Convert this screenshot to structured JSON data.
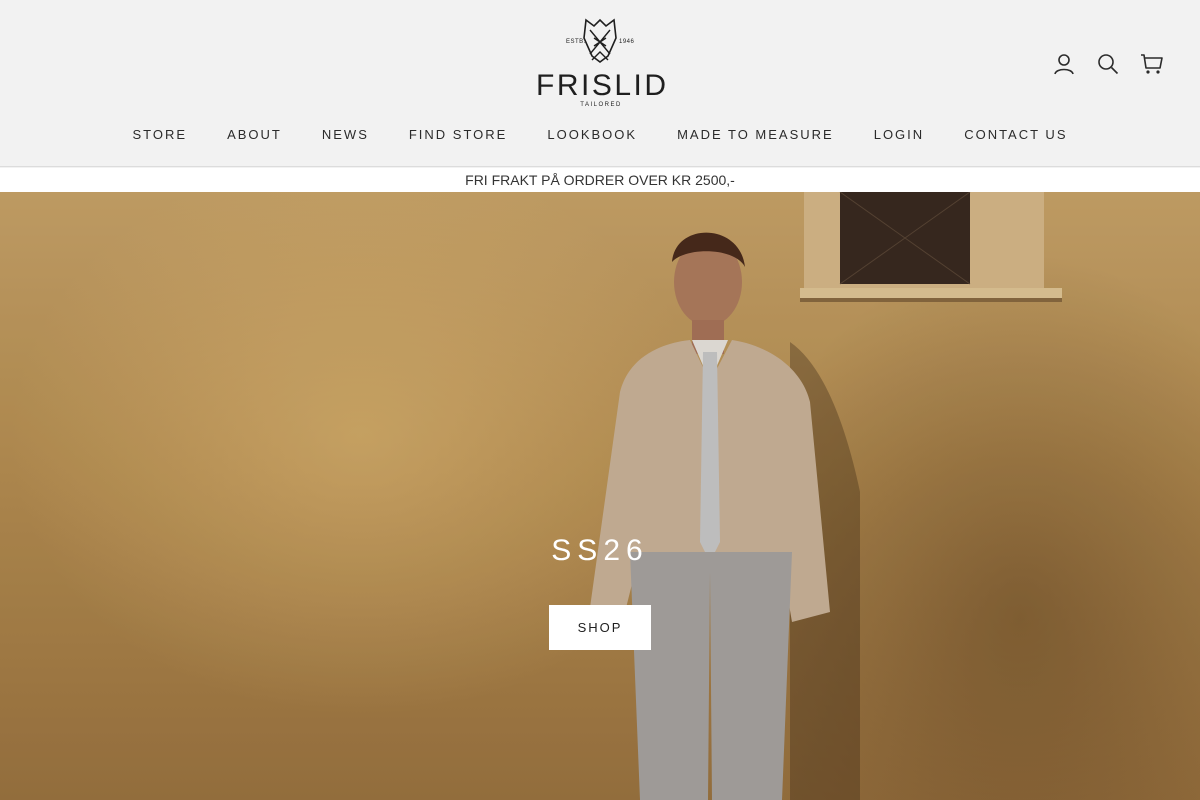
{
  "brand": {
    "name": "FRISLID",
    "tagline": "TAILORED",
    "estb": "ESTB.",
    "year": "1946"
  },
  "icons": {
    "account": "user-icon",
    "search": "search-icon",
    "cart": "cart-icon"
  },
  "nav": {
    "items": [
      {
        "label": "STORE"
      },
      {
        "label": "ABOUT"
      },
      {
        "label": "NEWS"
      },
      {
        "label": "FIND STORE"
      },
      {
        "label": "LOOKBOOK"
      },
      {
        "label": "MADE TO MEASURE"
      },
      {
        "label": "LOGIN"
      },
      {
        "label": "CONTACT US"
      }
    ]
  },
  "announcement": {
    "text": "FRI FRAKT PÅ ORDRER OVER KR 2500,-"
  },
  "hero": {
    "title": "SS26",
    "cta_label": "SHOP"
  },
  "colors": {
    "header_bg": "#f2f2f2",
    "text": "#2b2b2b",
    "hero_tone": "#b78f52",
    "cta_bg": "#ffffff"
  }
}
